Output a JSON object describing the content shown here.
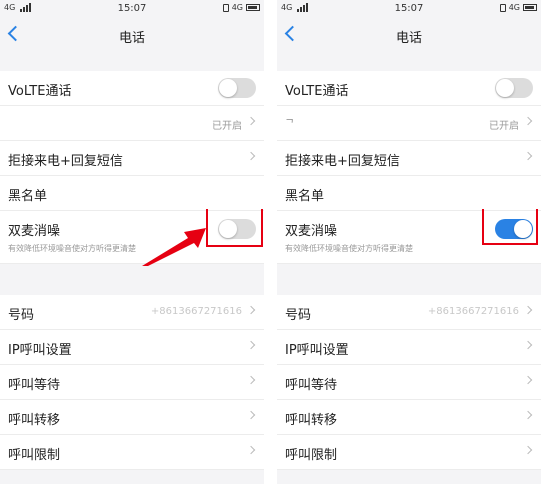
{
  "left": {
    "status": {
      "network": "4G",
      "time": "15:07",
      "net_right": "4G"
    },
    "nav": {
      "title": "电话"
    },
    "rows": {
      "volte": "VoLTE通话",
      "hidden_value": "已开启",
      "reject_sms": "拒接来电+回复短信",
      "blacklist": "黑名单",
      "noise_reduction": "双麦消噪",
      "noise_reduction_sub": "有效降低环境噪音使对方听得更清楚",
      "number": "号码",
      "number_value": "+8613667271616",
      "ip_call": "IP呼叫设置",
      "call_waiting": "呼叫等待",
      "call_forwarding": "呼叫转移",
      "call_barring": "呼叫限制"
    },
    "toggles": {
      "volte_on": false,
      "noise_reduction_on": false
    }
  },
  "right": {
    "status": {
      "network": "4G",
      "time": "15:07",
      "net_right": "4G"
    },
    "nav": {
      "title": "电话"
    },
    "rows": {
      "volte": "VoLTE通话",
      "partial_label": "ᄀ",
      "hidden_value": "已开启",
      "reject_sms": "拒接来电+回复短信",
      "blacklist": "黑名单",
      "noise_reduction": "双麦消噪",
      "noise_reduction_sub": "有效降低环境噪音使对方听得更清楚",
      "number": "号码",
      "number_value": "+8613667271616",
      "ip_call": "IP呼叫设置",
      "call_waiting": "呼叫等待",
      "call_forwarding": "呼叫转移",
      "call_barring": "呼叫限制"
    },
    "toggles": {
      "volte_on": false,
      "noise_reduction_on": true
    }
  },
  "colors": {
    "accent": "#2a82e4",
    "highlight": "#e60012",
    "toggle_off": "#dcdcdc"
  }
}
